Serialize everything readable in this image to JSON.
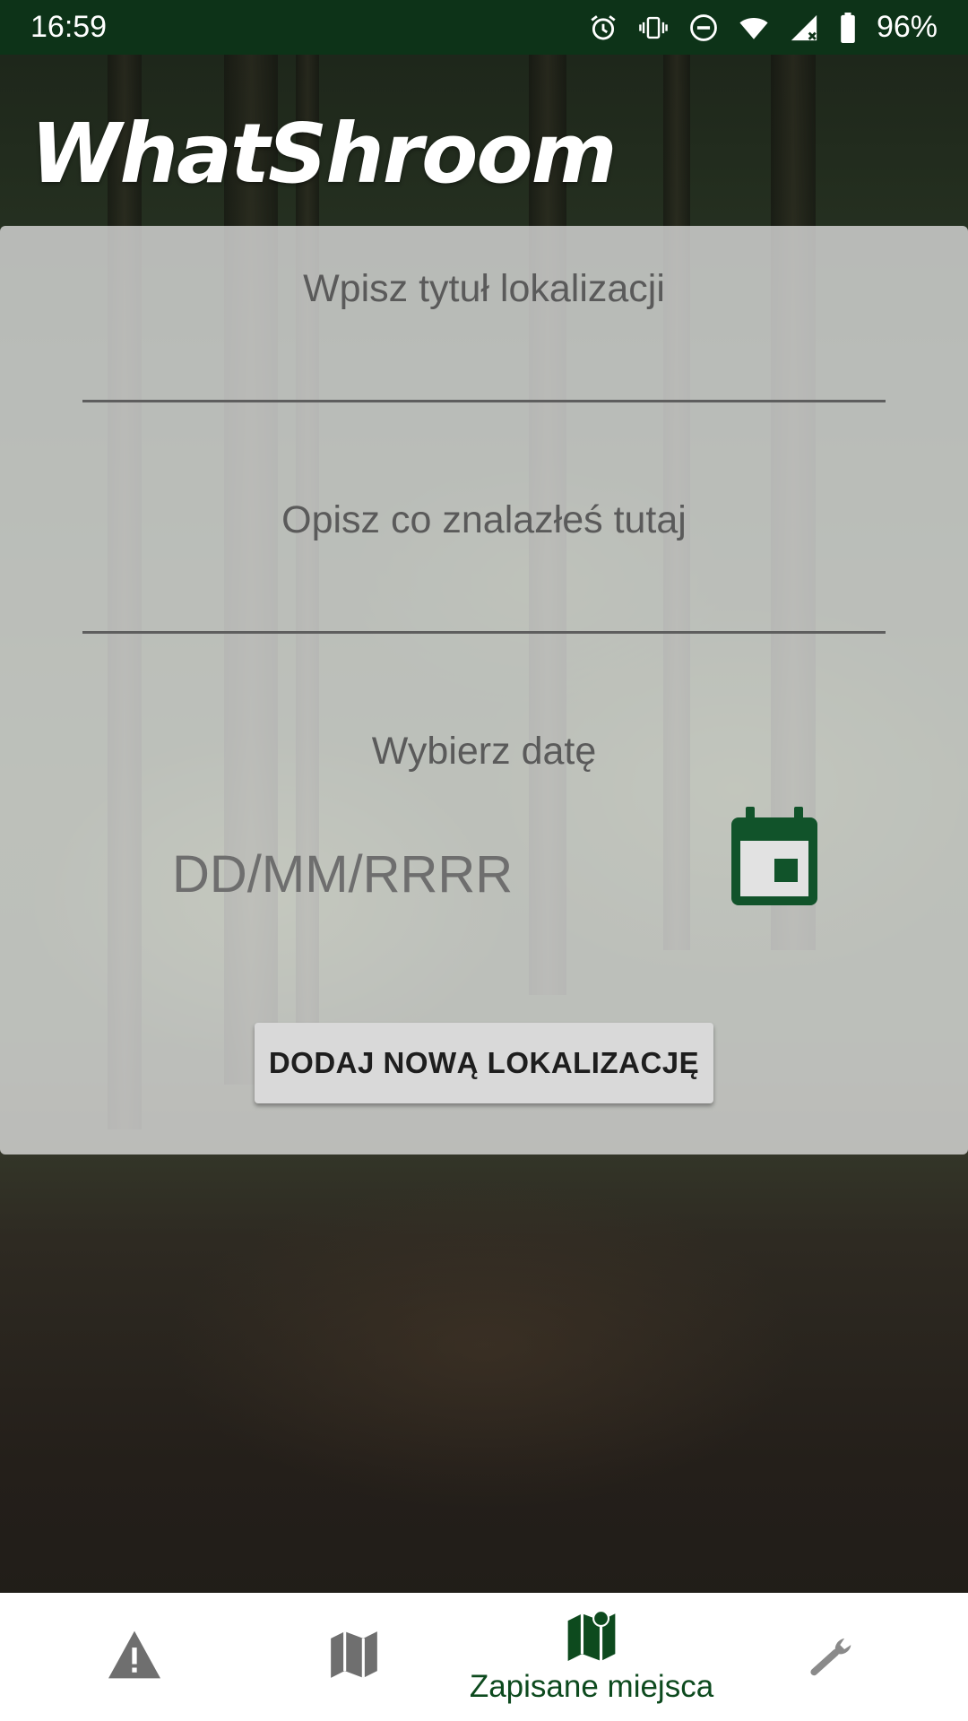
{
  "status_bar": {
    "time": "16:59",
    "battery": "96%",
    "icons": [
      "alarm-icon",
      "vibrate-icon",
      "do-not-disturb-icon",
      "wifi-icon",
      "signal-icon",
      "battery-icon"
    ]
  },
  "app": {
    "title": "WhatShroom"
  },
  "form": {
    "title_placeholder": "Wpisz tytuł lokalizacji",
    "description_placeholder": "Opisz co znalazłeś tutaj",
    "date_label": "Wybierz datę",
    "date_value": "DD/MM/RRRR",
    "add_button": "DODAJ NOWĄ LOKALIZACJĘ",
    "calendar_icon": "calendar-icon"
  },
  "bottom_nav": {
    "items": [
      {
        "icon": "warning-icon",
        "label": "",
        "active": false
      },
      {
        "icon": "map-icon",
        "label": "",
        "active": false
      },
      {
        "icon": "saved-places-map-icon",
        "label": "Zapisane miejsca",
        "active": true
      },
      {
        "icon": "wrench-icon",
        "label": "",
        "active": false
      }
    ]
  },
  "colors": {
    "status_bar": "#0d3318",
    "accent": "#0d4a1e",
    "inactive_icon": "#6f6f6f"
  }
}
